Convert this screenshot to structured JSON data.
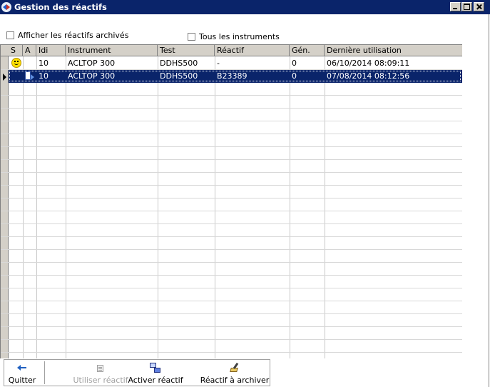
{
  "window": {
    "title": "Gestion des réactifs",
    "icon": "app-icon"
  },
  "filters": {
    "show_archived": {
      "label": "Afficher les réactifs archivés",
      "checked": false
    },
    "all_instruments": {
      "label": "Tous les instruments",
      "checked": false
    }
  },
  "grid": {
    "columns": [
      "S",
      "A",
      "Idi",
      "Instrument",
      "Test",
      "Réactif",
      "Gén.",
      "Dernière utilisation"
    ],
    "rows": [
      {
        "status_icon": "smiley-icon",
        "active_icon": "",
        "idi": "10",
        "instrument": "ACLTOP 300",
        "test": "DDHS500",
        "reagent": "-",
        "gen": "0",
        "last_use": "06/10/2014 08:09:11",
        "selected": false
      },
      {
        "status_icon": "",
        "active_icon": "active-reagent-icon",
        "idi": "10",
        "instrument": "ACLTOP 300",
        "test": "DDHS500",
        "reagent": "B23389",
        "gen": "0",
        "last_use": "07/08/2014 08:12:56",
        "selected": true
      }
    ]
  },
  "toolbar": {
    "quit": {
      "label": "Quitter",
      "icon": "arrow-left-icon",
      "enabled": true
    },
    "use_reagent": {
      "label": "Utiliser réactif",
      "icon": "use-reagent-icon",
      "enabled": false
    },
    "activate_reagent": {
      "label": "Activer réactif",
      "icon": "activate-reagent-icon",
      "enabled": true
    },
    "archive_reagent": {
      "label": "Réactif à archiver",
      "icon": "archive-icon",
      "enabled": true
    }
  },
  "colors": {
    "titlebar": "#0a246a",
    "selection": "#0a246a",
    "chrome": "#d4d0c8"
  }
}
